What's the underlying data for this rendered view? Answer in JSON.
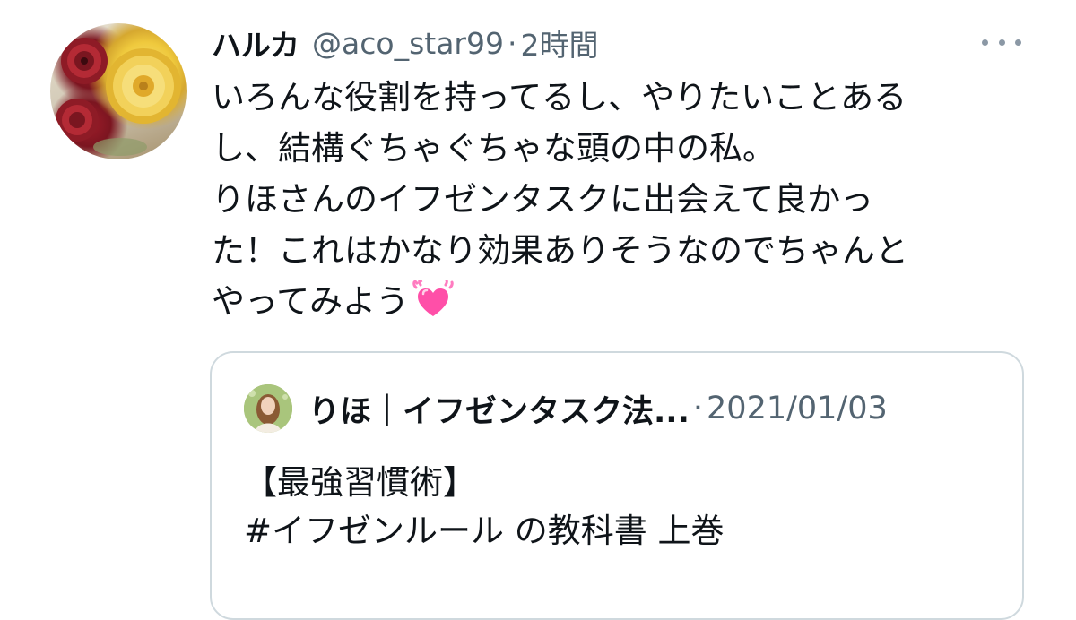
{
  "tweet": {
    "display_name": "ハルカ",
    "handle": "@aco_star99",
    "separator": "·",
    "time_ago": "2時間",
    "more_icon": "more-horizontal-icon",
    "avatar_icon": "flower-avatar",
    "text_lines": [
      "いろんな役割を持ってるし、やりたいことある",
      "し、結構ぐちゃぐちゃな頭の中の私。",
      "りほさんのイフゼンタスクに出会えて良かっ",
      "た！これはかなり効果ありそうなのでちゃんと",
      "やってみよう"
    ],
    "emoji": "growing-heart-emoji"
  },
  "quote": {
    "display_name": "りほ｜イフゼンタスク法...",
    "separator": "·",
    "date": "2021/01/03",
    "text_lines": [
      "【最強習慣術】",
      "#イフゼンルール の教科書 上巻"
    ]
  },
  "colors": {
    "text_primary": "#0f1419",
    "text_secondary": "#536471",
    "border": "#cfd9de",
    "heart": "#ff4fa8"
  }
}
